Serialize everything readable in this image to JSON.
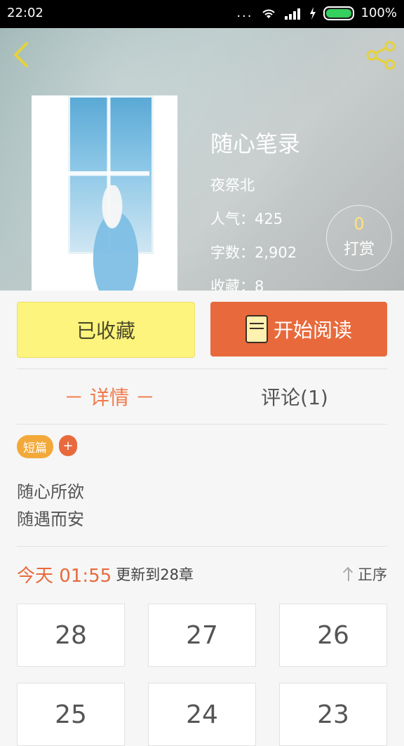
{
  "status": {
    "time": "22:02",
    "battery": "100%",
    "dots": "..."
  },
  "book": {
    "title": "随心笔录",
    "author": "夜祭北",
    "popularity": "人气：425",
    "word_count": "字数：2,902",
    "favorites": "收藏：8"
  },
  "reward": {
    "count": "0",
    "label": "打赏"
  },
  "actions": {
    "favorited_label": "已收藏",
    "start_reading_label": "开始阅读"
  },
  "tabs": {
    "details": "－ 详情 －",
    "comments": "评论(1)"
  },
  "tags": {
    "items": [
      "短篇"
    ],
    "add": "+"
  },
  "description": {
    "line1": "随心所欲",
    "line2": "随遇而安"
  },
  "update": {
    "today": "今天 01:55",
    "text": "更新到28章",
    "sort_label": "正序"
  },
  "chapters": [
    "28",
    "27",
    "26",
    "25",
    "24",
    "23"
  ],
  "colors": {
    "accent": "#e86a3c",
    "favorite": "#fdf47d",
    "tag": "#f3a93a"
  }
}
